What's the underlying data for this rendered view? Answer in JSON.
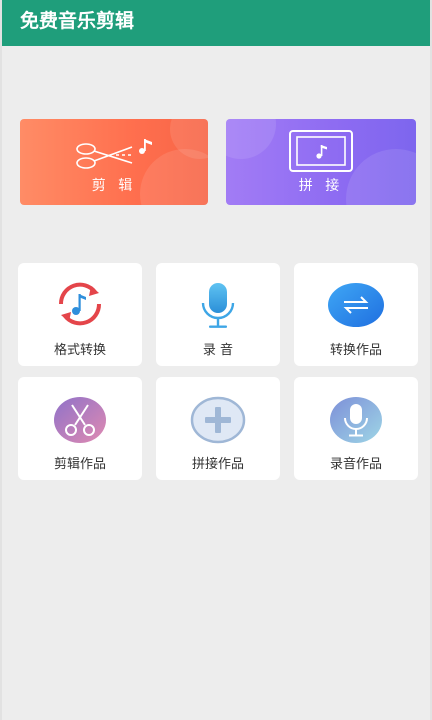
{
  "app": {
    "title": "免费音乐剪辑"
  },
  "colors": {
    "appbar": "#1f9e7b",
    "cut_card": "#ff7a57",
    "join_card": "#8d6bf2"
  },
  "feature_cards": [
    {
      "label": "剪 辑",
      "icon": "scissors-music-icon"
    },
    {
      "label": "拼 接",
      "icon": "frame-music-icon"
    }
  ],
  "tools": [
    {
      "label": "格式转换",
      "icon": "format-convert-icon"
    },
    {
      "label": "录 音",
      "icon": "microphone-icon"
    },
    {
      "label": "转换作品",
      "icon": "converted-works-icon"
    },
    {
      "label": "剪辑作品",
      "icon": "cut-works-icon"
    },
    {
      "label": "拼接作品",
      "icon": "join-works-icon"
    },
    {
      "label": "录音作品",
      "icon": "recording-works-icon"
    }
  ]
}
